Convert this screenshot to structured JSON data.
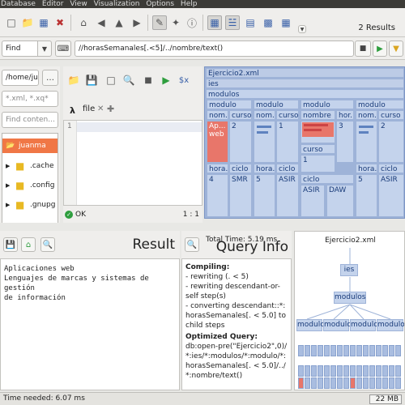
{
  "menubar": {
    "items": [
      "Database",
      "Editor",
      "View",
      "Visualization",
      "Options",
      "Help"
    ]
  },
  "toolbar": {
    "results": "2 Results"
  },
  "findbar": {
    "mode": "Find",
    "query": "//horasSemanales[.<5]/../nombre/text()"
  },
  "files": {
    "path": "/home/jua",
    "filter_placeholder": "*.xml, *.xq*",
    "content_placeholder": "Find conten...",
    "tree": [
      "juanma",
      ".cache",
      ".config",
      ".gnupg"
    ]
  },
  "editor": {
    "tab": "file",
    "line": "1",
    "status": "OK",
    "position": "1 : 1"
  },
  "xml_view": {
    "file": "Ejercicio2.xml",
    "root": "ies",
    "container": "modulos",
    "module": "modulo",
    "nombre": "nombre",
    "nombre_short": "nom...",
    "horas": "hor...",
    "horas_long": "hora...",
    "curso": "curso",
    "ciclo": "ciclo",
    "highlight_text": "Ap... web",
    "values": {
      "c1": "2",
      "c2": "1",
      "c3": "3",
      "c4": "2",
      "curso3": "1",
      "h1": "4",
      "h2": "5",
      "h3": "5",
      "h4": "5",
      "ci1": "SMR",
      "ci2": "ASIR",
      "ci3a": "ASIR",
      "ci3b": "DAW",
      "ci4": "ASIR"
    }
  },
  "result": {
    "title": "Result",
    "lines": [
      "Aplicaciones web",
      "Lenguajes de marcas y sistemas de gestión",
      "de información"
    ]
  },
  "query_info": {
    "title": "Query Info",
    "total_time": "Total Time: 5.19 ms",
    "compiling": "Compiling:",
    "steps": [
      "- rewriting (. < 5)",
      "- rewriting descendant-or-self step(s)",
      "- converting descendant::*:horasSemanales[. < 5.0] to child steps"
    ],
    "optimized": "Optimized Query:",
    "optimized_text": "db:open-pre(\"Ejercicio2\",0)/*:ies/*:modulos/*:modulo/*:horasSemanales[. < 5.0]/../*:nombre/text()"
  },
  "tree_view": {
    "root": "Ejercicio2.xml",
    "ies": "ies",
    "modulos": "modulos",
    "modulo": "modulo"
  },
  "status": {
    "time": "Time needed: 6.07 ms",
    "memory": "22 MB"
  }
}
